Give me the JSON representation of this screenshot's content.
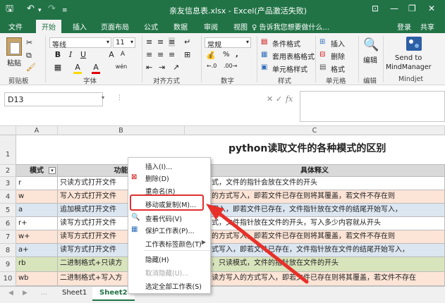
{
  "window": {
    "title": "亲友信息表.xlsx - Excel(产品激活失败)",
    "controls": {
      "ribbon_display": "⊡",
      "minimize": "—",
      "restore": "❐",
      "close": "✕"
    }
  },
  "quick_access": {
    "save_icon": "save-icon",
    "undo_icon": "undo-icon",
    "redo_icon": "redo-icon"
  },
  "tabs": [
    "文件",
    "开始",
    "插入",
    "页面布局",
    "公式",
    "数据",
    "审阅",
    "视图"
  ],
  "tell_me": "♀ 告诉我您想要做什么...",
  "account": {
    "login": "登录",
    "share": "共享"
  },
  "ribbon": {
    "clipboard": {
      "paste": "粘贴",
      "label": "剪贴板"
    },
    "font": {
      "name": "等线",
      "size": "11",
      "bold": "B",
      "italic": "I",
      "underline": "U",
      "grow": "A",
      "shrink": "A",
      "fill": "A",
      "color": "A",
      "phonetic": "wén",
      "label": "字体"
    },
    "alignment": {
      "label": "对齐方式"
    },
    "number": {
      "format": "常规",
      "currency": "%",
      "comma": ",",
      "label": "数字"
    },
    "styles": {
      "conditional": "条件格式",
      "table": "套用表格格式",
      "cell": "单元格样式",
      "label": "样式"
    },
    "cells": {
      "insert": "插入",
      "delete": "删除",
      "format": "格式",
      "label": "单元格"
    },
    "editing": {
      "label": "编辑",
      "title": "编辑"
    },
    "mindjet": {
      "send": "Send to",
      "target": "MindManager",
      "label": "Mindjet"
    }
  },
  "formula_bar": {
    "name_box": "D13",
    "cancel": "✕",
    "confirm": "✓",
    "fx": "fx"
  },
  "columns": {
    "A": "A",
    "B": "B",
    "C": "C"
  },
  "rows": {
    "r1": {
      "num": "1",
      "title": "python读取文件的各种模式的区别"
    },
    "r2": {
      "num": "2",
      "a": "模式",
      "b": "功能",
      "c": "具体释义"
    },
    "r3": {
      "num": "3",
      "a": "r",
      "b": "只读方式打开文件",
      "c": "式，文件的指针会放在文件的开头"
    },
    "r4": {
      "num": "4",
      "a": "w",
      "b": "写入方式打开文件",
      "c": "的方式写入，即若文件已存在则将其覆盖，若文件不存在则"
    },
    "r5": {
      "num": "5",
      "a": "a",
      "b": "追加模式打开文件",
      "c": "写入，即若文件已存在，文件指针放在文件的结尾开始写入，"
    },
    "r6": {
      "num": "6",
      "a": "r+",
      "b": "读写方式打开文件",
      "c": "式，文件指针放在文件的开头，写入多少内容就从开头"
    },
    "r7": {
      "num": "7",
      "a": "w+",
      "b": "读写方式打开文件",
      "c": "的方式写入，即若文件已存在则将其覆盖，若文件不存在则"
    },
    "r8": {
      "num": "8",
      "a": "a+",
      "b": "读写方式打开文件",
      "c": "式写入，即若文件已存在，文件指针放在文件的结尾开始写入，"
    },
    "r9": {
      "num": "9",
      "a": "rb",
      "b": "二进制格式+只读方",
      "c": "，只读模式，文件的指针放在文件的开头"
    },
    "r10": {
      "num": "10",
      "a": "wb",
      "b": "二进制格式+写入方",
      "c": "读方写入的方式写入，即若文件已存在则将其覆盖，若文件不存在"
    }
  },
  "sheets": [
    "Sheet1",
    "Sheet2"
  ],
  "context_menu": {
    "items": [
      "插入(I)...",
      "删除(D)",
      "重命名(R)",
      "移动或复制(M)...",
      "查看代码(V)",
      "保护工作表(P)...",
      "工作表标签颜色(T)",
      "隐藏(H)",
      "取消隐藏(U)...",
      "选定全部工作表(S)"
    ],
    "submenu_arrow": "▶",
    "icons": [
      "insert-icon",
      "delete-icon",
      "code-icon",
      "protect-icon"
    ]
  },
  "colors": {
    "excel_green": "#217346",
    "header_fill": "#d9d9d9",
    "row_blue": "#dce6f1",
    "row_orange": "#fce4d6",
    "row_green": "#d8e4bc",
    "highlight": "#e03030"
  }
}
